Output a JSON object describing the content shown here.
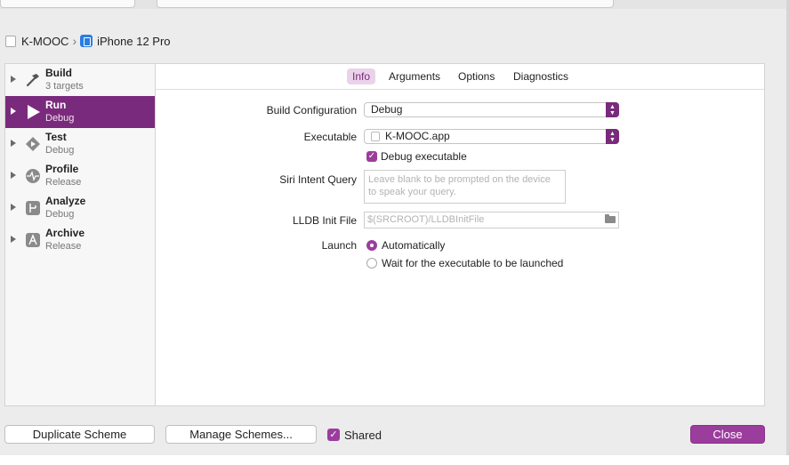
{
  "breadcrumb": {
    "project": "K-MOOC",
    "device": "iPhone 12 Pro"
  },
  "sidebar": {
    "items": [
      {
        "name": "Build",
        "sub": "3 targets",
        "icon": "hammer-icon",
        "selected": false
      },
      {
        "name": "Run",
        "sub": "Debug",
        "icon": "play-icon",
        "selected": true
      },
      {
        "name": "Test",
        "sub": "Debug",
        "icon": "diamond-play-icon",
        "selected": false
      },
      {
        "name": "Profile",
        "sub": "Release",
        "icon": "waveform-icon",
        "selected": false
      },
      {
        "name": "Analyze",
        "sub": "Debug",
        "icon": "analyze-icon",
        "selected": false
      },
      {
        "name": "Archive",
        "sub": "Release",
        "icon": "archive-icon",
        "selected": false
      }
    ]
  },
  "tabs": {
    "info": "Info",
    "arguments": "Arguments",
    "options": "Options",
    "diagnostics": "Diagnostics",
    "active": "Info"
  },
  "form": {
    "build_configuration_label": "Build Configuration",
    "build_configuration_value": "Debug",
    "executable_label": "Executable",
    "executable_value": "K-MOOC.app",
    "debug_executable_label": "Debug executable",
    "debug_executable_checked": true,
    "siri_label": "Siri Intent Query",
    "siri_placeholder": "Leave blank to be prompted on the device to speak your query.",
    "lldb_label": "LLDB Init File",
    "lldb_placeholder": "$(SRCROOT)/LLDBInitFile",
    "launch_label": "Launch",
    "launch_auto": "Automatically",
    "launch_wait": "Wait for the executable to be launched",
    "launch_selected": "Automatically"
  },
  "footer": {
    "duplicate": "Duplicate Scheme",
    "manage": "Manage Schemes...",
    "shared": "Shared",
    "shared_checked": true,
    "close": "Close"
  },
  "colors": {
    "accent": "#9b3d9d",
    "selection": "#7a2a7c"
  }
}
